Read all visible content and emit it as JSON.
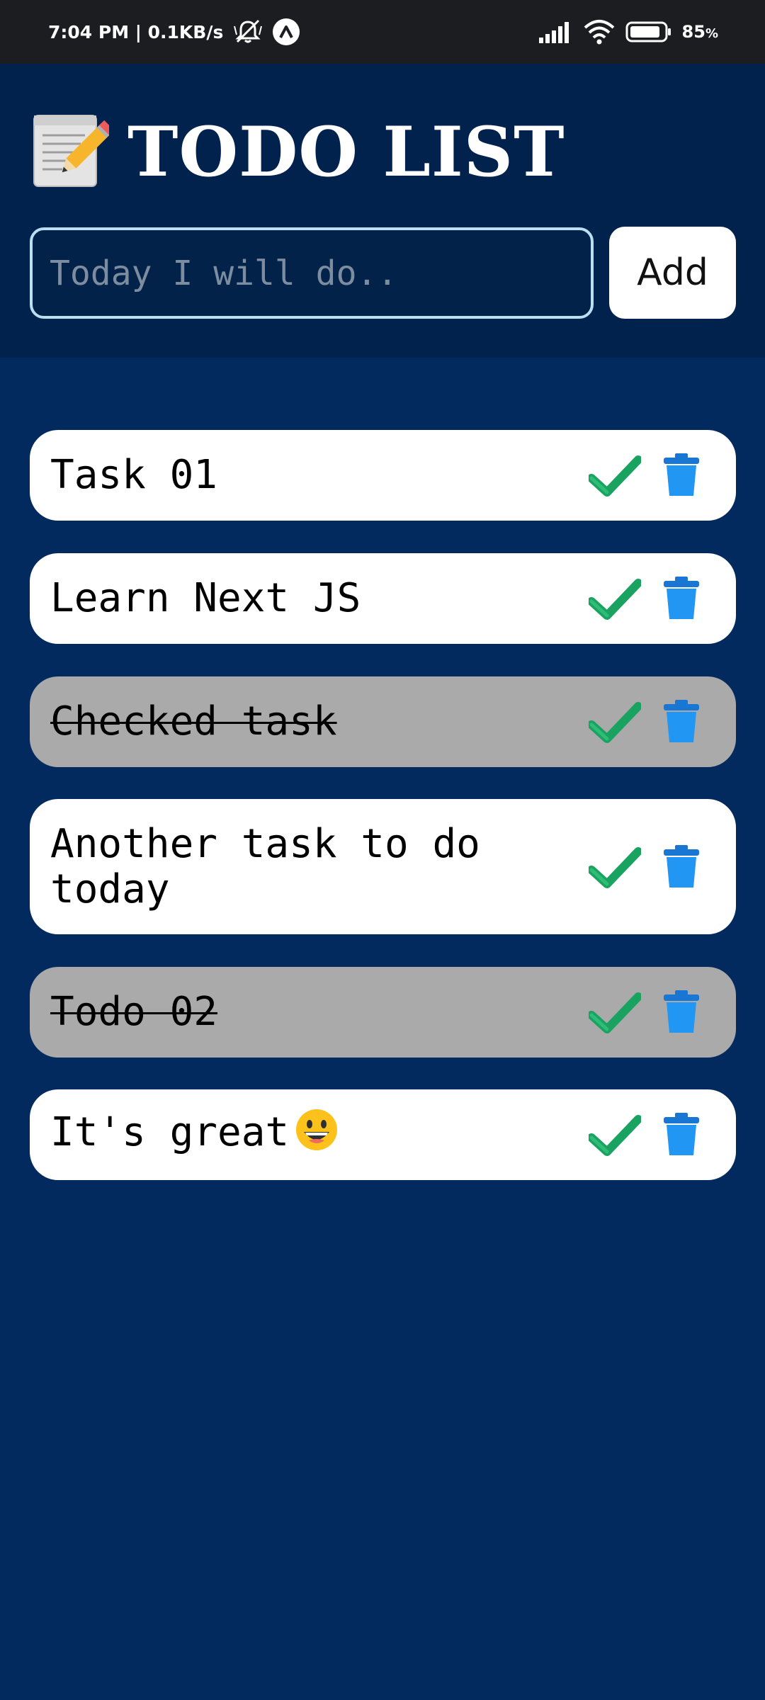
{
  "status_bar": {
    "time_speed": "7:04 PM | 0.1KB/s",
    "battery": "85",
    "battery_unit": "%"
  },
  "header": {
    "title": "TODO LIST",
    "title_icon": "memo-pencil-icon"
  },
  "input": {
    "placeholder": "Today I will do..",
    "value": ""
  },
  "add_button": {
    "label": "Add"
  },
  "todos": [
    {
      "text": "Task 01",
      "completed": false
    },
    {
      "text": "Learn Next JS",
      "completed": false
    },
    {
      "text": "Checked task",
      "completed": true
    },
    {
      "text": "Another task to do today",
      "completed": false
    },
    {
      "text": "Todo 02",
      "completed": true
    },
    {
      "text": "It's great",
      "emoji": "grinning-face-icon",
      "completed": false
    }
  ],
  "icons": {
    "complete": "check-mark-icon",
    "delete": "trash-icon"
  },
  "colors": {
    "background": "#022a5e",
    "header_bg": "#01224d",
    "item_bg": "#ffffff",
    "item_done_bg": "#aaaaaa",
    "check": "#1aa260",
    "trash": "#2196f3",
    "input_border": "#b9dff0"
  }
}
